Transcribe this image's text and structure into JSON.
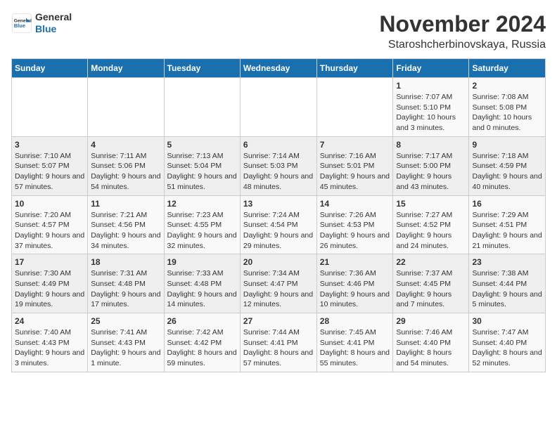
{
  "header": {
    "logo_line1": "General",
    "logo_line2": "Blue",
    "month": "November 2024",
    "location": "Staroshcherbinovskaya, Russia"
  },
  "weekdays": [
    "Sunday",
    "Monday",
    "Tuesday",
    "Wednesday",
    "Thursday",
    "Friday",
    "Saturday"
  ],
  "weeks": [
    [
      {
        "day": "",
        "info": ""
      },
      {
        "day": "",
        "info": ""
      },
      {
        "day": "",
        "info": ""
      },
      {
        "day": "",
        "info": ""
      },
      {
        "day": "",
        "info": ""
      },
      {
        "day": "1",
        "info": "Sunrise: 7:07 AM\nSunset: 5:10 PM\nDaylight: 10 hours and 3 minutes."
      },
      {
        "day": "2",
        "info": "Sunrise: 7:08 AM\nSunset: 5:08 PM\nDaylight: 10 hours and 0 minutes."
      }
    ],
    [
      {
        "day": "3",
        "info": "Sunrise: 7:10 AM\nSunset: 5:07 PM\nDaylight: 9 hours and 57 minutes."
      },
      {
        "day": "4",
        "info": "Sunrise: 7:11 AM\nSunset: 5:06 PM\nDaylight: 9 hours and 54 minutes."
      },
      {
        "day": "5",
        "info": "Sunrise: 7:13 AM\nSunset: 5:04 PM\nDaylight: 9 hours and 51 minutes."
      },
      {
        "day": "6",
        "info": "Sunrise: 7:14 AM\nSunset: 5:03 PM\nDaylight: 9 hours and 48 minutes."
      },
      {
        "day": "7",
        "info": "Sunrise: 7:16 AM\nSunset: 5:01 PM\nDaylight: 9 hours and 45 minutes."
      },
      {
        "day": "8",
        "info": "Sunrise: 7:17 AM\nSunset: 5:00 PM\nDaylight: 9 hours and 43 minutes."
      },
      {
        "day": "9",
        "info": "Sunrise: 7:18 AM\nSunset: 4:59 PM\nDaylight: 9 hours and 40 minutes."
      }
    ],
    [
      {
        "day": "10",
        "info": "Sunrise: 7:20 AM\nSunset: 4:57 PM\nDaylight: 9 hours and 37 minutes."
      },
      {
        "day": "11",
        "info": "Sunrise: 7:21 AM\nSunset: 4:56 PM\nDaylight: 9 hours and 34 minutes."
      },
      {
        "day": "12",
        "info": "Sunrise: 7:23 AM\nSunset: 4:55 PM\nDaylight: 9 hours and 32 minutes."
      },
      {
        "day": "13",
        "info": "Sunrise: 7:24 AM\nSunset: 4:54 PM\nDaylight: 9 hours and 29 minutes."
      },
      {
        "day": "14",
        "info": "Sunrise: 7:26 AM\nSunset: 4:53 PM\nDaylight: 9 hours and 26 minutes."
      },
      {
        "day": "15",
        "info": "Sunrise: 7:27 AM\nSunset: 4:52 PM\nDaylight: 9 hours and 24 minutes."
      },
      {
        "day": "16",
        "info": "Sunrise: 7:29 AM\nSunset: 4:51 PM\nDaylight: 9 hours and 21 minutes."
      }
    ],
    [
      {
        "day": "17",
        "info": "Sunrise: 7:30 AM\nSunset: 4:49 PM\nDaylight: 9 hours and 19 minutes."
      },
      {
        "day": "18",
        "info": "Sunrise: 7:31 AM\nSunset: 4:48 PM\nDaylight: 9 hours and 17 minutes."
      },
      {
        "day": "19",
        "info": "Sunrise: 7:33 AM\nSunset: 4:48 PM\nDaylight: 9 hours and 14 minutes."
      },
      {
        "day": "20",
        "info": "Sunrise: 7:34 AM\nSunset: 4:47 PM\nDaylight: 9 hours and 12 minutes."
      },
      {
        "day": "21",
        "info": "Sunrise: 7:36 AM\nSunset: 4:46 PM\nDaylight: 9 hours and 10 minutes."
      },
      {
        "day": "22",
        "info": "Sunrise: 7:37 AM\nSunset: 4:45 PM\nDaylight: 9 hours and 7 minutes."
      },
      {
        "day": "23",
        "info": "Sunrise: 7:38 AM\nSunset: 4:44 PM\nDaylight: 9 hours and 5 minutes."
      }
    ],
    [
      {
        "day": "24",
        "info": "Sunrise: 7:40 AM\nSunset: 4:43 PM\nDaylight: 9 hours and 3 minutes."
      },
      {
        "day": "25",
        "info": "Sunrise: 7:41 AM\nSunset: 4:43 PM\nDaylight: 9 hours and 1 minute."
      },
      {
        "day": "26",
        "info": "Sunrise: 7:42 AM\nSunset: 4:42 PM\nDaylight: 8 hours and 59 minutes."
      },
      {
        "day": "27",
        "info": "Sunrise: 7:44 AM\nSunset: 4:41 PM\nDaylight: 8 hours and 57 minutes."
      },
      {
        "day": "28",
        "info": "Sunrise: 7:45 AM\nSunset: 4:41 PM\nDaylight: 8 hours and 55 minutes."
      },
      {
        "day": "29",
        "info": "Sunrise: 7:46 AM\nSunset: 4:40 PM\nDaylight: 8 hours and 54 minutes."
      },
      {
        "day": "30",
        "info": "Sunrise: 7:47 AM\nSunset: 4:40 PM\nDaylight: 8 hours and 52 minutes."
      }
    ]
  ]
}
